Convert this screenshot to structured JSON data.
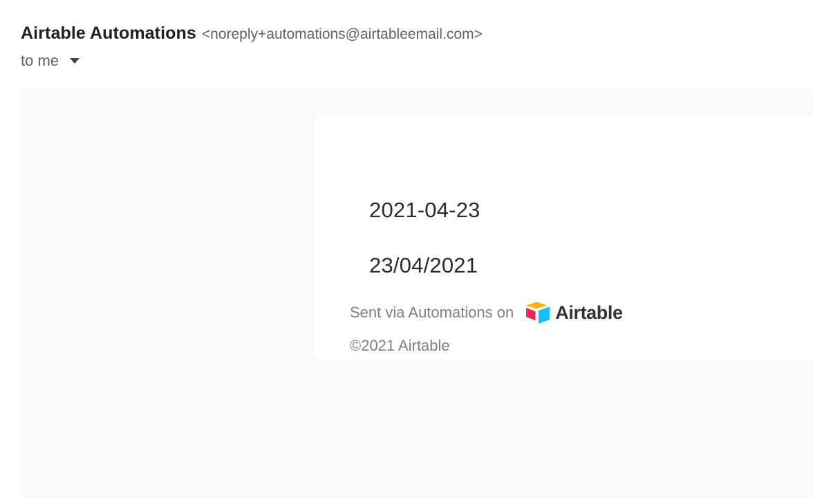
{
  "email": {
    "sender_name": "Airtable Automations",
    "sender_email": "<noreply+automations@airtableemail.com>",
    "recipient": "to me",
    "recipient_toggle_icon": "caret-down-icon"
  },
  "body": {
    "dates": [
      "2021-04-23",
      "23/04/2021"
    ],
    "footer": {
      "sent_via": "Sent via Automations on",
      "brand_logo_icon": "airtable-logo-icon",
      "brand_name": "Airtable",
      "copyright": "©2021 Airtable"
    }
  },
  "colors": {
    "body_background": "#f9f9f9",
    "card_background": "#ffffff",
    "muted_text": "#808080",
    "logo_yellow": "#fcb400",
    "logo_red": "#f82b60",
    "logo_blue": "#18bfff"
  }
}
